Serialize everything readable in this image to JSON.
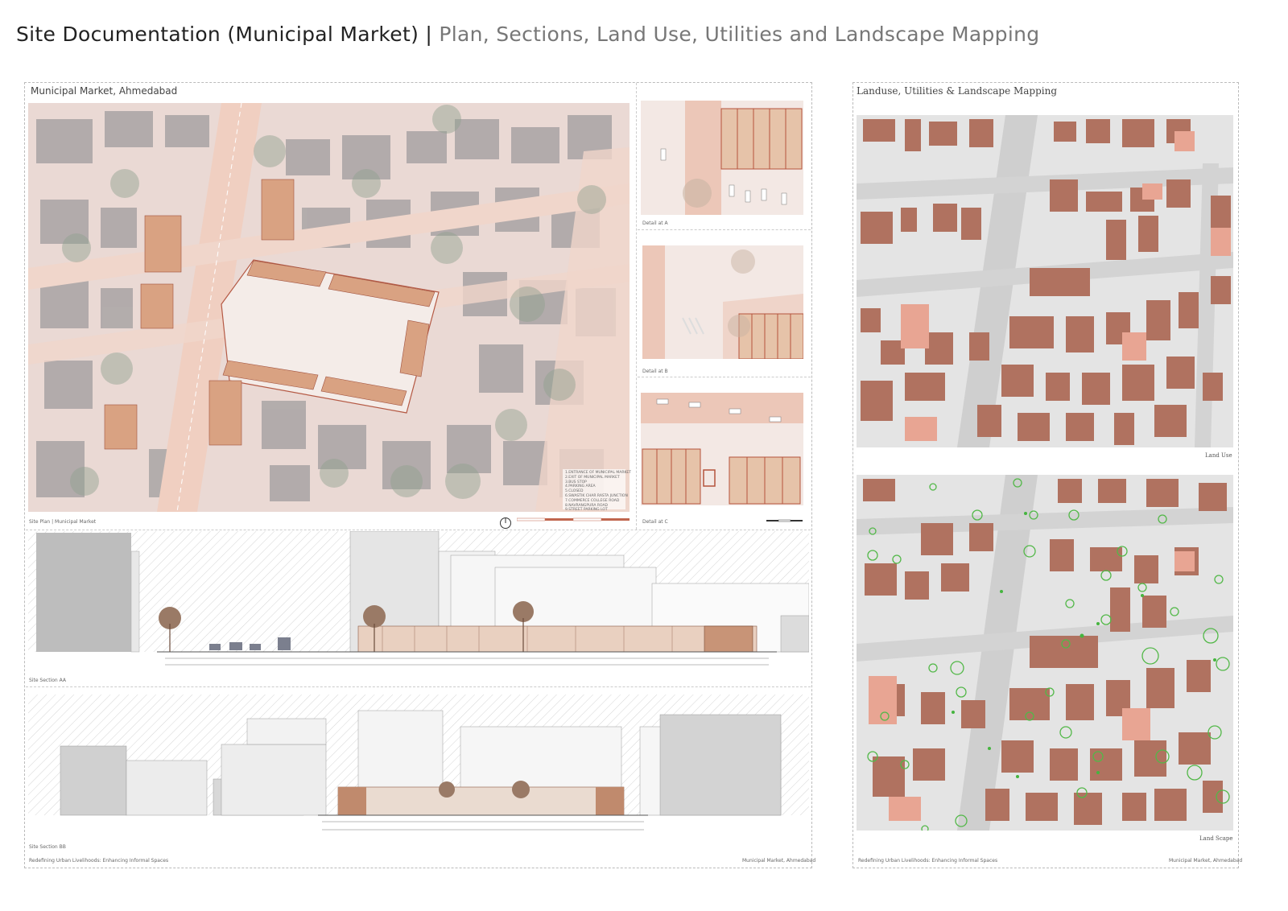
{
  "header": {
    "title": "Site Documentation (Municipal Market) |",
    "subtitle": "Plan, Sections, Land Use, Utilities and Landscape Mapping"
  },
  "left_board": {
    "plan_title": "Municipal Market, Ahmedabad",
    "plan_caption": "Site Plan | Municipal Market",
    "legend": [
      "1.ENTRANCE OF MUNICIPAL MARKET",
      "2.EXIT OF MUNICIPAL MARKET",
      "3.BUS STOP",
      "4.PARKING AREA",
      "5.CLOSED",
      "6.SWASTIK CHAR RASTA JUNCTION",
      "7.COMMERCE COLLEGE ROAD",
      "8.NAVRANGPURA ROAD",
      "9.STREET PARKING LOT"
    ],
    "detail_a": "Detail at A",
    "detail_b": "Detail at B",
    "detail_c": "Detail at C",
    "section_aa": "Site Section AA",
    "section_bb": "Site Section BB",
    "footer_left": "Redefining Urban Livelihoods: Enhancing Informal Spaces",
    "footer_right": "Municipal Market, Ahmedabad"
  },
  "right_board": {
    "title": "Landuse, Utilities & Landscape Mapping",
    "landuse_caption": "Land Use",
    "landscape_caption": "Land Scape",
    "footer_left": "Redefining Urban Livelihoods: Enhancing Informal Spaces",
    "footer_right": "Municipal Market, Ahmedabad"
  },
  "colors": {
    "road": "#f3dcd2",
    "roadGray": "#d8d8d8",
    "building": "#a8a3a3",
    "market": "#d9a07f",
    "landuseBuilding": "#b07260",
    "landuseLight": "#e8a593",
    "tree": "#4caf50"
  }
}
